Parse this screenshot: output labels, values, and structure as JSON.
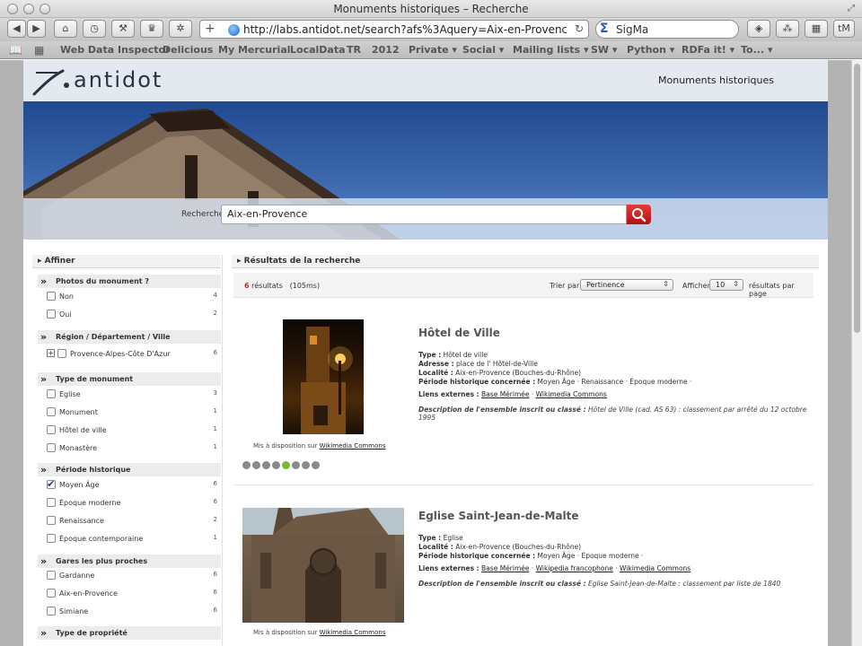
{
  "browser": {
    "window_title": "Monuments historiques – Recherche",
    "url": "http://labs.antidot.net/search?afs%3Aquery=Aix-en-Provence&searc",
    "search_engine_text": "SigMa",
    "bookmarks": [
      "Web Data Inspector",
      "Delicious",
      "My Mercurial",
      "LocalData",
      "TR",
      "2012",
      "Private ▾",
      "Social ▾",
      "Mailing lists ▾",
      "SW ▾",
      "Python ▾",
      "RDFa it! ▾",
      "To... ▾"
    ],
    "menu_button": "tM"
  },
  "header": {
    "logo_text": "antidot",
    "site_link": "Monuments historiques"
  },
  "search": {
    "label": "Recherche",
    "query": "Aix-en-Provence"
  },
  "sidebar": {
    "title": "Affiner",
    "facets": [
      {
        "title": "Photos du monument ?",
        "items": [
          {
            "label": "Non",
            "count": "4",
            "checked": false
          },
          {
            "label": "Oui",
            "count": "2",
            "checked": false
          }
        ]
      },
      {
        "title": "Région / Département / Ville",
        "items": [
          {
            "label": "Provence-Alpes-Côte D'Azur",
            "count": "6",
            "checked": false,
            "expandable": true
          }
        ]
      },
      {
        "title": "Type de monument",
        "items": [
          {
            "label": "Eglise",
            "count": "3",
            "checked": false
          },
          {
            "label": "Monument",
            "count": "1",
            "checked": false
          },
          {
            "label": "Hôtel de ville",
            "count": "1",
            "checked": false
          },
          {
            "label": "Monastère",
            "count": "1",
            "checked": false
          }
        ]
      },
      {
        "title": "Période historique",
        "items": [
          {
            "label": "Moyen Âge",
            "count": "6",
            "checked": true
          },
          {
            "label": "Époque moderne",
            "count": "6",
            "checked": false
          },
          {
            "label": "Renaissance",
            "count": "2",
            "checked": false
          },
          {
            "label": "Époque contemporaine",
            "count": "1",
            "checked": false
          }
        ]
      },
      {
        "title": "Gares les plus proches",
        "items": [
          {
            "label": "Gardanne",
            "count": "6",
            "checked": false
          },
          {
            "label": "Aix-en-Provence",
            "count": "6",
            "checked": false
          },
          {
            "label": "Simiane",
            "count": "6",
            "checked": false
          }
        ]
      },
      {
        "title": "Type de propriété",
        "items": []
      }
    ]
  },
  "results": {
    "title": "Résultats de la recherche",
    "count": "6",
    "count_suffix": " résultats",
    "time": "(105ms)",
    "sort_label": "Trier par",
    "sort_value": "Pertinence",
    "show_label": "Afficher",
    "show_value": "10",
    "per_page_label": "résultats par page",
    "items": [
      {
        "title": "Hôtel de Ville",
        "type_label": "Type :",
        "type": "Hôtel de ville",
        "address_label": "Adresse :",
        "address": "place de l' Hôtel-de-Ville",
        "locality_label": "Localité :",
        "locality": "Aix-en-Provence (Bouches-du-Rhône)",
        "period_label": "Période historique concernée :",
        "period": "Moyen Âge · Renaissance · Époque moderne ·",
        "links_label": "Liens externes :",
        "links": [
          "Base Mérimée",
          "Wikimedia Commons"
        ],
        "desc_label": "Description de l'ensemble inscrit ou classé :",
        "desc": "Hôtel de Ville (cad. AS 63) : classement par arrêté du 12 octobre 1995",
        "credit_text": "Mis à disposition sur",
        "credit_link": "Wikimedia Commons",
        "carousel_dots": 8,
        "carousel_active": 5
      },
      {
        "title": "Eglise Saint-Jean-de-Malte",
        "type_label": "Type :",
        "type": "Eglise",
        "locality_label": "Localité :",
        "locality": "Aix-en-Provence (Bouches-du-Rhône)",
        "period_label": "Période historique concernée :",
        "period": "Moyen Âge · Époque moderne ·",
        "links_label": "Liens externes :",
        "links": [
          "Base Mérimée",
          "Wikipedia francophone",
          "Wikimedia Commons"
        ],
        "desc_label": "Description de l'ensemble inscrit ou classé :",
        "desc": "Eglise Saint-Jean-de-Malte : classement par liste de 1840",
        "credit_text": "Mis à disposition sur",
        "credit_link": "Wikimedia Commons"
      }
    ]
  },
  "colors": {
    "accent_red": "#c92222",
    "header_bg": "#e4e8ef",
    "active_dot": "#7db83a"
  }
}
